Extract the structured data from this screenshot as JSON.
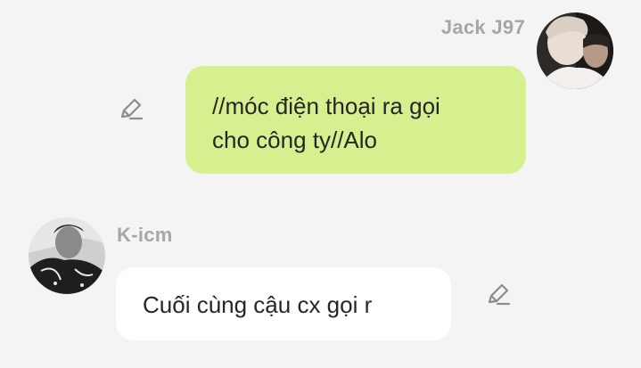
{
  "messages": {
    "sent": {
      "sender": "Jack J97",
      "lines": [
        "//móc điện thoại ra gọi",
        "cho công ty//Alo"
      ],
      "bubble_color": "#d7f08f",
      "edit_icon": "pencil-icon"
    },
    "received": {
      "sender": "K-icm",
      "text": "Cuối cùng cậu cx gọi r",
      "bubble_color": "#ffffff",
      "edit_icon": "pencil-icon"
    }
  },
  "colors": {
    "background": "#f4f4f4",
    "name_text": "#a7a7a7",
    "message_text": "#262626"
  }
}
